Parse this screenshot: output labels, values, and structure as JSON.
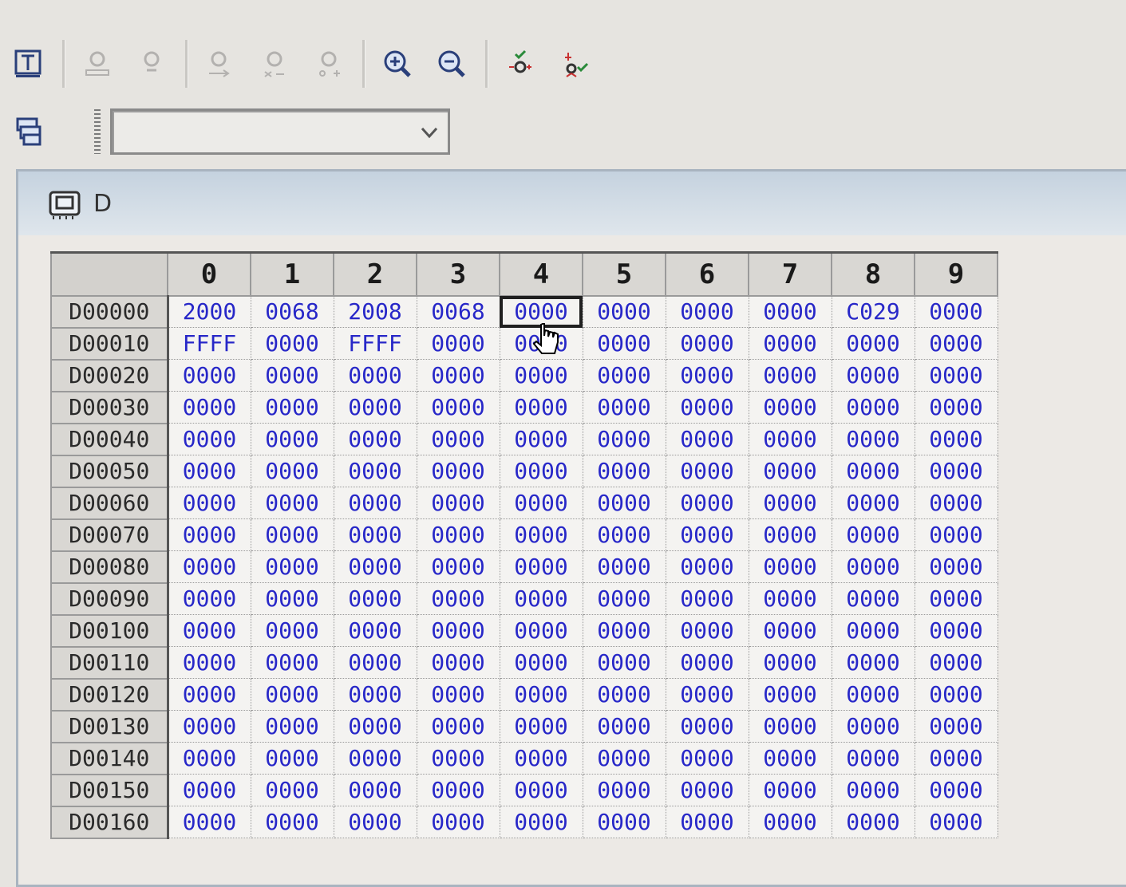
{
  "toolbar": {
    "row1_icons": [
      "text-mode-icon",
      "watch-icon-1",
      "watch-icon-2",
      "monitor-icon-1",
      "monitor-icon-2",
      "monitor-icon-3",
      "zoom-in-icon",
      "zoom-out-icon",
      "set-device-icon",
      "reset-device-icon"
    ],
    "row2_icons": [
      "window-layout-icon"
    ],
    "combo": {
      "value": ""
    }
  },
  "window": {
    "title": "D"
  },
  "grid": {
    "columns": [
      "0",
      "1",
      "2",
      "3",
      "4",
      "5",
      "6",
      "7",
      "8",
      "9"
    ],
    "rows": [
      {
        "label": "D00000",
        "cells": [
          "2000",
          "0068",
          "2008",
          "0068",
          "0000",
          "0000",
          "0000",
          "0000",
          "C029",
          "0000"
        ]
      },
      {
        "label": "D00010",
        "cells": [
          "FFFF",
          "0000",
          "FFFF",
          "0000",
          "0030",
          "0000",
          "0000",
          "0000",
          "0000",
          "0000"
        ]
      },
      {
        "label": "D00020",
        "cells": [
          "0000",
          "0000",
          "0000",
          "0000",
          "0000",
          "0000",
          "0000",
          "0000",
          "0000",
          "0000"
        ]
      },
      {
        "label": "D00030",
        "cells": [
          "0000",
          "0000",
          "0000",
          "0000",
          "0000",
          "0000",
          "0000",
          "0000",
          "0000",
          "0000"
        ]
      },
      {
        "label": "D00040",
        "cells": [
          "0000",
          "0000",
          "0000",
          "0000",
          "0000",
          "0000",
          "0000",
          "0000",
          "0000",
          "0000"
        ]
      },
      {
        "label": "D00050",
        "cells": [
          "0000",
          "0000",
          "0000",
          "0000",
          "0000",
          "0000",
          "0000",
          "0000",
          "0000",
          "0000"
        ]
      },
      {
        "label": "D00060",
        "cells": [
          "0000",
          "0000",
          "0000",
          "0000",
          "0000",
          "0000",
          "0000",
          "0000",
          "0000",
          "0000"
        ]
      },
      {
        "label": "D00070",
        "cells": [
          "0000",
          "0000",
          "0000",
          "0000",
          "0000",
          "0000",
          "0000",
          "0000",
          "0000",
          "0000"
        ]
      },
      {
        "label": "D00080",
        "cells": [
          "0000",
          "0000",
          "0000",
          "0000",
          "0000",
          "0000",
          "0000",
          "0000",
          "0000",
          "0000"
        ]
      },
      {
        "label": "D00090",
        "cells": [
          "0000",
          "0000",
          "0000",
          "0000",
          "0000",
          "0000",
          "0000",
          "0000",
          "0000",
          "0000"
        ]
      },
      {
        "label": "D00100",
        "cells": [
          "0000",
          "0000",
          "0000",
          "0000",
          "0000",
          "0000",
          "0000",
          "0000",
          "0000",
          "0000"
        ]
      },
      {
        "label": "D00110",
        "cells": [
          "0000",
          "0000",
          "0000",
          "0000",
          "0000",
          "0000",
          "0000",
          "0000",
          "0000",
          "0000"
        ]
      },
      {
        "label": "D00120",
        "cells": [
          "0000",
          "0000",
          "0000",
          "0000",
          "0000",
          "0000",
          "0000",
          "0000",
          "0000",
          "0000"
        ]
      },
      {
        "label": "D00130",
        "cells": [
          "0000",
          "0000",
          "0000",
          "0000",
          "0000",
          "0000",
          "0000",
          "0000",
          "0000",
          "0000"
        ]
      },
      {
        "label": "D00140",
        "cells": [
          "0000",
          "0000",
          "0000",
          "0000",
          "0000",
          "0000",
          "0000",
          "0000",
          "0000",
          "0000"
        ]
      },
      {
        "label": "D00150",
        "cells": [
          "0000",
          "0000",
          "0000",
          "0000",
          "0000",
          "0000",
          "0000",
          "0000",
          "0000",
          "0000"
        ]
      },
      {
        "label": "D00160",
        "cells": [
          "0000",
          "0000",
          "0000",
          "0000",
          "0000",
          "0000",
          "0000",
          "0000",
          "0000",
          "0000"
        ]
      }
    ],
    "selected": {
      "row": 0,
      "col": 4
    }
  },
  "colors": {
    "value_text": "#2727c8",
    "title_bar": "#c5d2df"
  }
}
